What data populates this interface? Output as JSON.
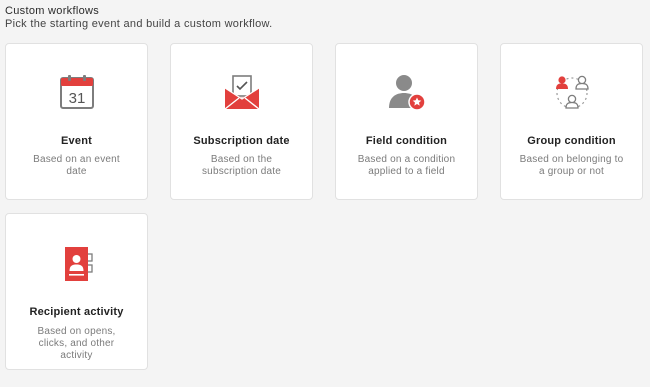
{
  "header": {
    "title": "Custom workflows",
    "subtitle": "Pick the starting event and build a custom workflow."
  },
  "colors": {
    "accent": "#e2403d",
    "icon_gray": "#8a8a8a",
    "background": "#f4f4f4",
    "card": "#ffffff"
  },
  "cards": [
    {
      "icon": "calendar-icon",
      "icon_text": "31",
      "name": "Event",
      "description": "Based on an event date"
    },
    {
      "icon": "envelope-icon",
      "name": "Subscription date",
      "description": "Based on the subscription date"
    },
    {
      "icon": "user-star-icon",
      "name": "Field condition",
      "description": "Based on a condition applied to a field"
    },
    {
      "icon": "user-group-icon",
      "name": "Group condition",
      "description": "Based on belonging to a group or not"
    },
    {
      "icon": "contact-book-icon",
      "name": "Recipient activity",
      "description": "Based on opens, clicks, and other activity"
    }
  ]
}
